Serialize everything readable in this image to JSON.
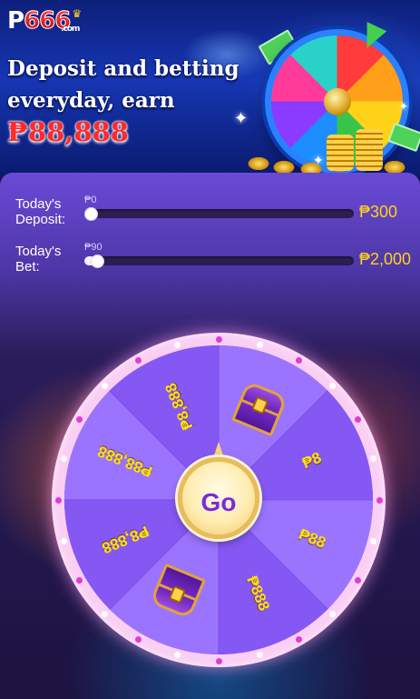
{
  "banner": {
    "logo_prefix": "P",
    "logo_digits": "666",
    "logo_suffix": ".com",
    "headline": "Deposit and betting everyday, earn",
    "prize": "₱88,888"
  },
  "progress": [
    {
      "label": "Today's Deposit:",
      "current": "₱0",
      "target": "₱300",
      "fraction": 0.0
    },
    {
      "label": "Today's Bet:",
      "current": "₱90",
      "target": "₱2,000",
      "fraction": 0.045
    }
  ],
  "wheel": {
    "go_label": "Go",
    "segments": [
      {
        "type": "chest",
        "label": ""
      },
      {
        "type": "text",
        "label": "₱8"
      },
      {
        "type": "text",
        "label": "₱88"
      },
      {
        "type": "text",
        "label": "₱888"
      },
      {
        "type": "chest",
        "label": ""
      },
      {
        "type": "text",
        "label": "₱8,888"
      },
      {
        "type": "text",
        "label": "₱88,888"
      },
      {
        "type": "text",
        "label": "₱8,888"
      }
    ],
    "colors": {
      "light": "#9a74ff",
      "dark": "#8558f3",
      "rim": "#f8c8f2",
      "accent_text": "#ffe01e"
    }
  }
}
